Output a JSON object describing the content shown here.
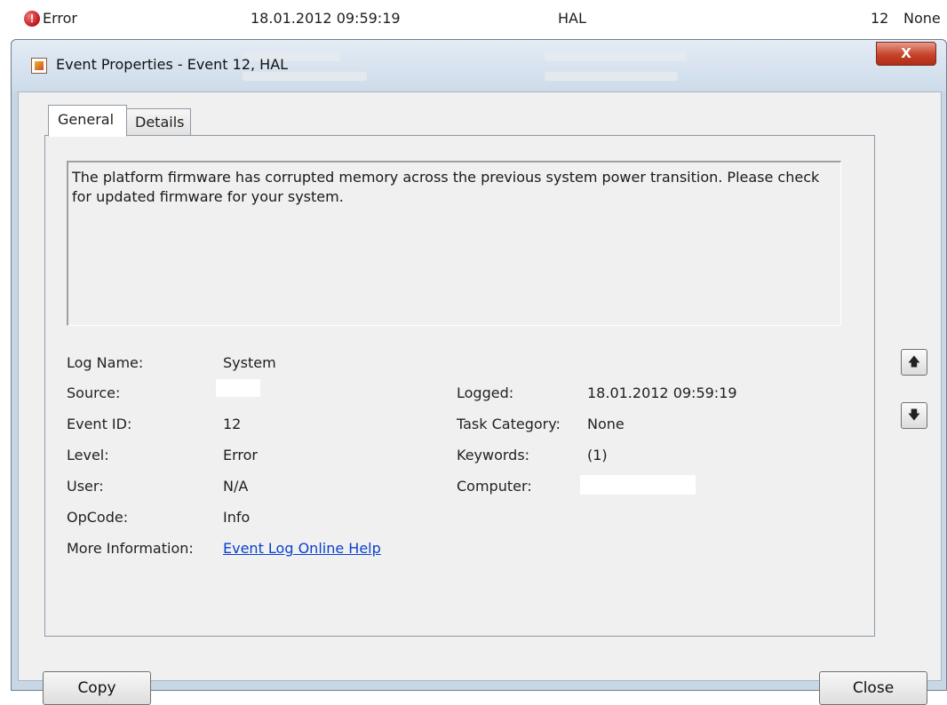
{
  "event_row": {
    "level": "Error",
    "date_time": "18.01.2012 09:59:19",
    "source": "HAL",
    "event_id": "12",
    "task_category": "None"
  },
  "dialog": {
    "title": "Event Properties - Event 12, HAL",
    "close_glyph": "X"
  },
  "tabs": [
    {
      "label": "General",
      "active": true
    },
    {
      "label": "Details",
      "active": false
    }
  ],
  "general": {
    "description": "The platform firmware has corrupted memory across the previous system power transition.  Please check for updated firmware for your system.",
    "labels": {
      "log_name": "Log Name:",
      "source": "Source:",
      "event_id": "Event ID:",
      "level": "Level:",
      "user": "User:",
      "opcode": "OpCode:",
      "more_info": "More Information:",
      "logged": "Logged:",
      "task_category": "Task Category:",
      "keywords": "Keywords:",
      "computer": "Computer:"
    },
    "values": {
      "log_name": "System",
      "source": "",
      "event_id": "12",
      "level": "Error",
      "user": "N/A",
      "opcode": "Info",
      "more_info_link": "Event Log Online Help",
      "logged": "18.01.2012 09:59:19",
      "task_category": "None",
      "keywords": "(1)",
      "computer": ""
    }
  },
  "nav": {
    "up_glyph": "🡅",
    "down_glyph": "🡇"
  },
  "buttons": {
    "copy": "Copy",
    "close": "Close"
  },
  "colors": {
    "link": "#0a3fcf",
    "window_frame": "#c8d7e6",
    "close_button": "#c5432a",
    "error_icon": "#c0141c"
  }
}
